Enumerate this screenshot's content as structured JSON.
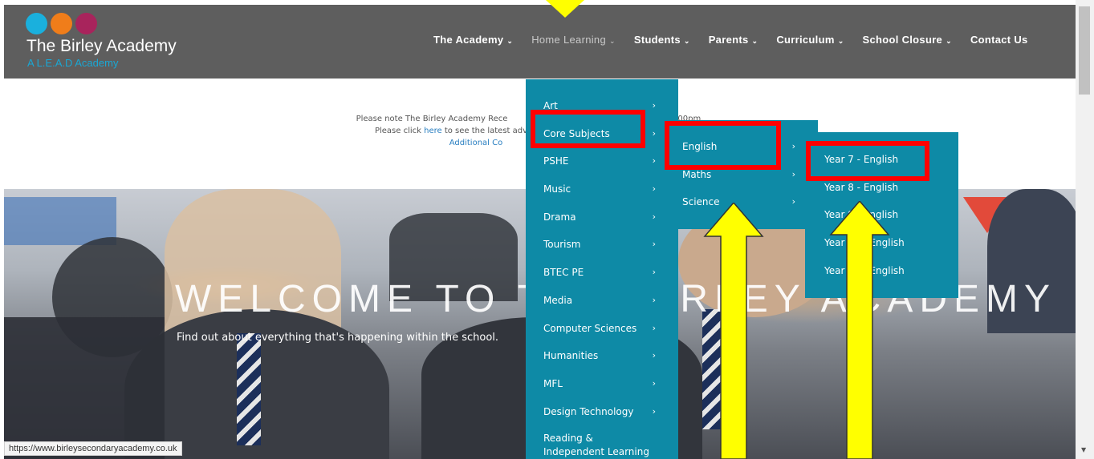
{
  "site": {
    "title": "The Birley Academy",
    "subtitle": "A L.E.A.D Academy",
    "subtitle_color": "#1aa7d4",
    "logo_dot_colors": [
      "#1ab0dd",
      "#f07d1a",
      "#a8245c"
    ]
  },
  "nav": {
    "items": [
      {
        "label": "The Academy",
        "caret": "⌄"
      },
      {
        "label": "Home Learning",
        "caret": "⌄"
      },
      {
        "label": "Students",
        "caret": "⌄"
      },
      {
        "label": "Parents",
        "caret": "⌄"
      },
      {
        "label": "Curriculum",
        "caret": "⌄"
      },
      {
        "label": "School Closure",
        "caret": "⌄"
      },
      {
        "label": "Contact Us",
        "caret": ""
      }
    ]
  },
  "notice": {
    "line1": "Please note The Birley Academy Rece",
    "line1_tail": "00pm.",
    "line2_pre": "Please click ",
    "line2_link": "here",
    "line2_post": " to see the latest adv",
    "line3": "Additional Co"
  },
  "hero": {
    "title": "WELCOME TO THE BIRLEY ACADEMY",
    "subtitle": "Find out about everything that's happening within the school."
  },
  "menu1": {
    "items": [
      {
        "label": "Art",
        "chev": "›"
      },
      {
        "label": "Core Subjects",
        "chev": "›"
      },
      {
        "label": "PSHE",
        "chev": "›"
      },
      {
        "label": "Music",
        "chev": "›"
      },
      {
        "label": "Drama",
        "chev": "›"
      },
      {
        "label": "Tourism",
        "chev": "›"
      },
      {
        "label": "BTEC PE",
        "chev": "›"
      },
      {
        "label": "Media",
        "chev": "›"
      },
      {
        "label": "Computer Sciences",
        "chev": "›"
      },
      {
        "label": "Humanities",
        "chev": "›"
      },
      {
        "label": "MFL",
        "chev": "›"
      },
      {
        "label": "Design Technology",
        "chev": "›"
      },
      {
        "label": "Reading &",
        "chev": ""
      },
      {
        "label": "Independent Learning",
        "chev": ""
      }
    ]
  },
  "menu2": {
    "items": [
      {
        "label": "English",
        "chev": "›"
      },
      {
        "label": "Maths",
        "chev": "›"
      },
      {
        "label": "Science",
        "chev": "›"
      }
    ]
  },
  "menu3": {
    "items": [
      {
        "label": "Year 7 - English"
      },
      {
        "label": "Year 8 - English"
      },
      {
        "label": "Year 9 - English"
      },
      {
        "label": "Year 10 - English"
      },
      {
        "label": "Year 11 - English"
      }
    ]
  },
  "status_url": "https://www.birleysecondaryacademy.co.uk",
  "colors": {
    "header_bg": "#5e5e5e",
    "menu_bg": "#0e8aa6",
    "highlight": "#ff0000",
    "arrow": "#ffff00"
  }
}
